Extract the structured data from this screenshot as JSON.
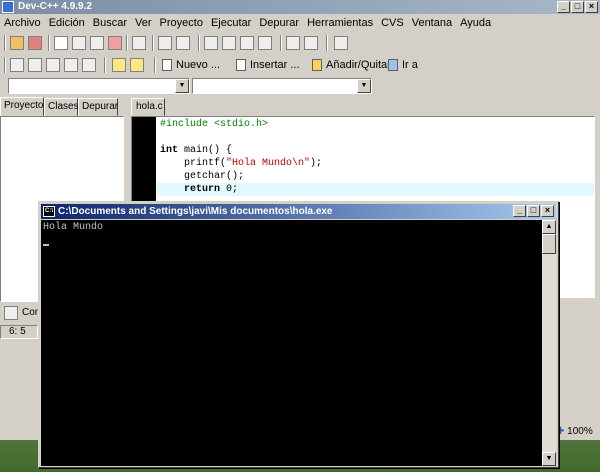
{
  "ide": {
    "title": "Dev-C++ 4.9.9.2",
    "menus": [
      "Archivo",
      "Edición",
      "Buscar",
      "Ver",
      "Proyecto",
      "Ejecutar",
      "Depurar",
      "Herramientas",
      "CVS",
      "Ventana",
      "Ayuda"
    ],
    "toolbar2": {
      "new_label": "Nuevo ...",
      "insert_label": "Insertar ...",
      "toggle_label": "Añadir/Quitar",
      "goto_label": "Ir a"
    },
    "left_tabs": [
      "Proyecto",
      "Clases",
      "Depurar"
    ],
    "editor_tab": "hola.c",
    "code": {
      "line1": "#include <stdio.h>",
      "line3_kw": "int",
      "line3": " main() {",
      "line4_a": "    printf(",
      "line4_str": "\"Hola Mundo\\n\"",
      "line4_b": ");",
      "line5": "    getchar();",
      "line6_kw": "return",
      "line6": " 0;"
    },
    "bottom_label": "Com",
    "status_pos": "6: 5",
    "zoom": "100%"
  },
  "console": {
    "title": "C:\\Documents and Settings\\javi\\Mis documentos\\hola.exe",
    "output": "Hola Mundo"
  },
  "colors": {
    "accent_title": "#0a246a",
    "code_string": "#c00000",
    "code_preprocessor": "#008000"
  }
}
